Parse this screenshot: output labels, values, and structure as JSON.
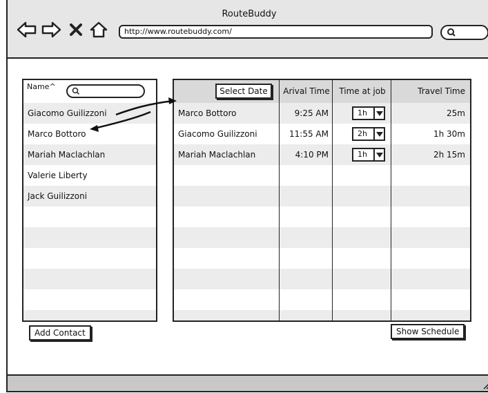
{
  "window": {
    "title": "RouteBuddy"
  },
  "toolbar": {
    "back_icon": "back-arrow-icon",
    "forward_icon": "forward-arrow-icon",
    "close_icon": "close-icon",
    "home_icon": "home-icon",
    "url": "http://www.routebuddy.com/",
    "search_placeholder": ""
  },
  "contacts": {
    "header_label": "Name^",
    "search_placeholder": "",
    "items": [
      {
        "name": "Giacomo Guilizzoni"
      },
      {
        "name": "Marco Bottoro"
      },
      {
        "name": "Mariah Maclachlan"
      },
      {
        "name": "Valerie Liberty"
      },
      {
        "name": "Jack Guilizzoni"
      }
    ],
    "add_button": "Add Contact"
  },
  "schedule": {
    "select_date_button": "Select Date",
    "headers": [
      "Arival Time",
      "Time at job",
      "Travel Time"
    ],
    "rows": [
      {
        "name": "Marco Bottoro",
        "arrival": "9:25 AM",
        "time_at_job": "1h",
        "travel": "25m"
      },
      {
        "name": "Giacomo Guilizzoni",
        "arrival": "11:55 AM",
        "time_at_job": "2h",
        "travel": "1h 30m"
      },
      {
        "name": "Mariah Maclachlan",
        "arrival": "4:10 PM",
        "time_at_job": "1h",
        "travel": "2h 15m"
      }
    ],
    "show_schedule_button": "Show Schedule"
  },
  "colors": {
    "toolbar_bg": "#e6e6e6",
    "row_alt": "#ececec",
    "header_bg": "#d9d9d9",
    "statusbar_bg": "#c8c8c8",
    "stroke": "#222222"
  }
}
